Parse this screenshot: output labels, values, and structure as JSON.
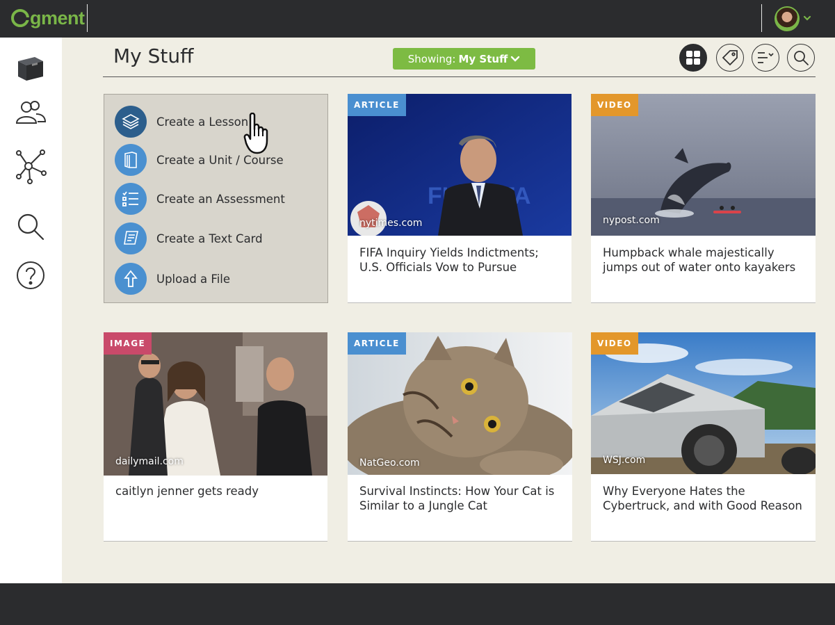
{
  "app": {
    "logo_text": "gment",
    "brand_color": "#7ab648"
  },
  "header": {
    "title": "My Stuff",
    "showing_prefix": "Showing:",
    "showing_value": "My Stuff",
    "buttons": [
      "grid-view-icon",
      "tag-icon",
      "sort-list-icon",
      "search-icon"
    ]
  },
  "sidebar": {
    "items": [
      {
        "name": "my-stuff",
        "icon": "archive-box-icon"
      },
      {
        "name": "groups",
        "icon": "users-icon"
      },
      {
        "name": "network",
        "icon": "network-icon"
      },
      {
        "name": "search",
        "icon": "search-icon"
      },
      {
        "name": "help",
        "icon": "question-icon"
      }
    ]
  },
  "create_menu": {
    "items": [
      {
        "label": "Create a Lesson",
        "icon": "layers-icon"
      },
      {
        "label": "Create a Unit / Course",
        "icon": "book-icon"
      },
      {
        "label": "Create an Assessment",
        "icon": "checklist-icon"
      },
      {
        "label": "Create a Text Card",
        "icon": "scroll-icon"
      },
      {
        "label": "Upload a File",
        "icon": "upload-arrow-icon"
      }
    ]
  },
  "cards": [
    {
      "tag": "ARTICLE",
      "source": "nytimes.com",
      "title": "FIFA Inquiry Yields Indictments; U.S. Officials Vow to Pursue"
    },
    {
      "tag": "VIDEO",
      "source": "nypost.com",
      "title": "Humpback whale majestically jumps out of water onto kayakers"
    },
    {
      "tag": "IMAGE",
      "source": "dailymail.com",
      "title": "caitlyn jenner gets ready"
    },
    {
      "tag": "ARTICLE",
      "source": "NatGeo.com",
      "title": "Survival Instincts: How Your Cat is Similar to a Jungle Cat"
    },
    {
      "tag": "VIDEO",
      "source": "WSJ.com",
      "title": "Why Everyone Hates the Cybertruck, and with Good Reason"
    }
  ],
  "colors": {
    "topbar": "#2b2c2e",
    "background": "#f0eee4",
    "showing_green": "#7dbb43",
    "article_tag": "#4a8fd0",
    "video_tag": "#e3972b",
    "image_tag": "#c94a6a",
    "create_icon": "#4a90d0"
  }
}
